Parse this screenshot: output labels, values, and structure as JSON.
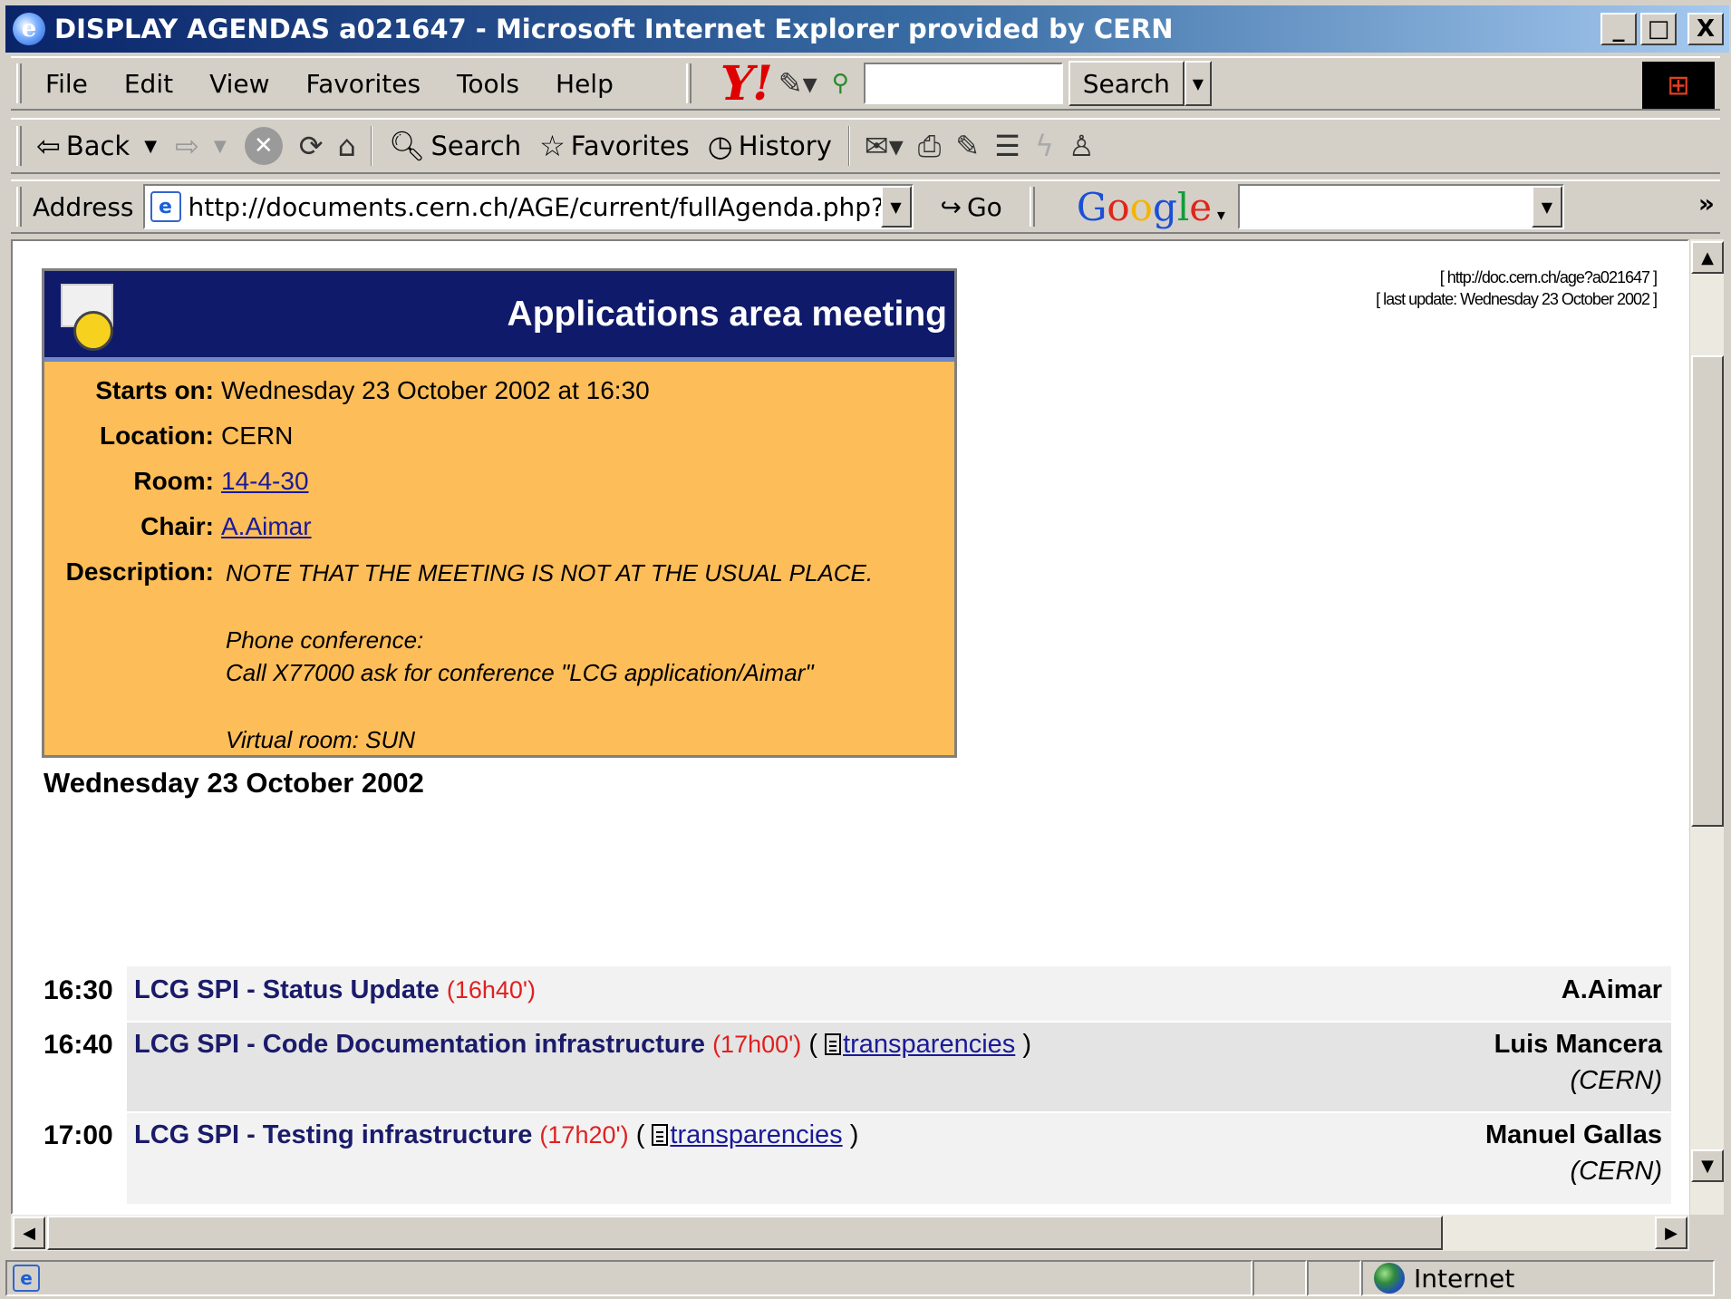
{
  "window": {
    "title": "DISPLAY AGENDAS a021647 - Microsoft Internet Explorer provided by CERN",
    "controls": [
      "_",
      "□",
      "X"
    ]
  },
  "menu": [
    "File",
    "Edit",
    "View",
    "Favorites",
    "Tools",
    "Help"
  ],
  "yahoo": {
    "logo": "Y!",
    "search_label": "Search"
  },
  "nav": {
    "back": "Back",
    "search": "Search",
    "favorites": "Favorites",
    "history": "History"
  },
  "address": {
    "label": "Address",
    "url": "http://documents.cern.ch/AGE/current/fullAgenda.php?ida=",
    "go": "Go",
    "google": "Google",
    "more": "»"
  },
  "agenda": {
    "title": "Applications area meeting",
    "link": "[ http://doc.cern.ch/age?a021647 ]",
    "last_update": "[ last update: Wednesday 23 October 2002 ]",
    "starts_on_label": "Starts on:",
    "starts_on": "Wednesday 23 October 2002 at 16:30",
    "location_label": "Location:",
    "location": "CERN",
    "room_label": "Room:",
    "room": "14-4-30",
    "chair_label": "Chair:",
    "chair": "A.Aimar",
    "description_label": "Description:",
    "description_lines": [
      "NOTE THAT THE MEETING IS NOT AT THE USUAL PLACE.",
      "Phone conference:",
      "Call X77000 ask for conference \"LCG application/Aimar\"",
      "Virtual room: SUN"
    ]
  },
  "day": "Wednesday 23 October 2002",
  "timetable": [
    {
      "time": "16:30",
      "title": "LCG SPI - Status Update",
      "end": "(16h40')",
      "speaker": "A.Aimar"
    },
    {
      "time": "16:40",
      "title": "LCG SPI - Code Documentation infrastructure",
      "end": "(17h00')",
      "material": "transparencies",
      "speaker": "Luis Mancera",
      "affiliation": "(CERN)"
    },
    {
      "time": "17:00",
      "title": "LCG SPI - Testing infrastructure",
      "end": "(17h20')",
      "material": "transparencies",
      "speaker": "Manuel Gallas",
      "affiliation": "(CERN)"
    }
  ],
  "status": {
    "zone": "Internet"
  },
  "colors": {
    "header": "#0f1a6b",
    "agenda_bg": "#fdbd58",
    "title_link": "#1b1b6b",
    "end_time": "#e02020"
  }
}
